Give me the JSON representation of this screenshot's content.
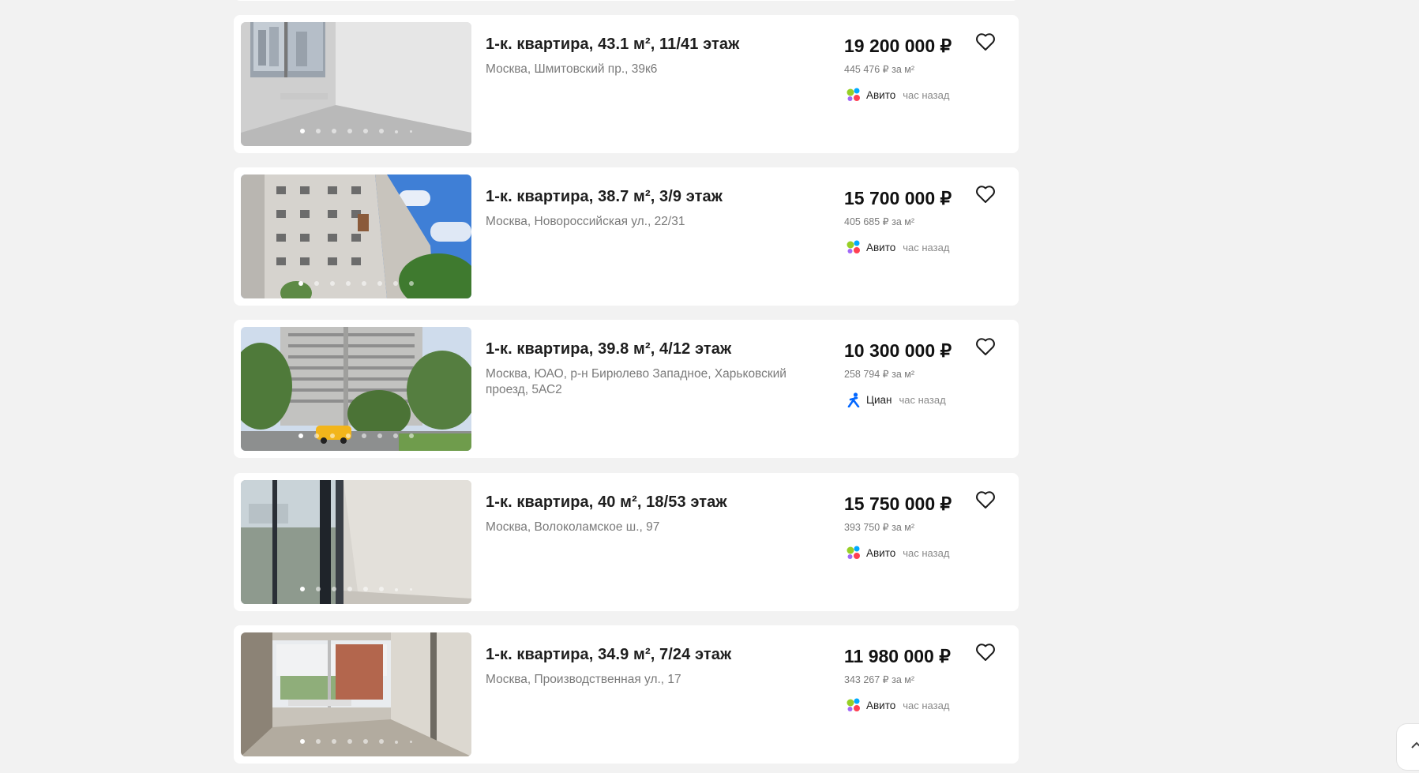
{
  "listings": [
    {
      "title": "1-к. квартира, 43.1 м², 11/41 этаж",
      "address": "Москва, Шмитовский пр., 39к6",
      "price": "19 200 000 ₽",
      "price_per_m2": "445 476 ₽ за м²",
      "source": "Авито",
      "source_icon": "avito-icon",
      "time": "час назад",
      "photo_icon": "empty-room-photo"
    },
    {
      "title": "1-к. квартира, 38.7 м², 3/9 этаж",
      "address": "Москва, Новороссийская ул., 22/31",
      "price": "15 700 000 ₽",
      "price_per_m2": "405 685 ₽ за м²",
      "source": "Авито",
      "source_icon": "avito-icon",
      "time": "час назад",
      "photo_icon": "building-exterior-photo"
    },
    {
      "title": "1-к. квартира, 39.8 м², 4/12 этаж",
      "address": "Москва, ЮАО, р-н Бирюлево Западное, Харьковский проезд, 5АС2",
      "price": "10 300 000 ₽",
      "price_per_m2": "258 794 ₽ за м²",
      "source": "Циан",
      "source_icon": "cian-icon",
      "time": "час назад",
      "photo_icon": "building-street-photo"
    },
    {
      "title": "1-к. квартира, 40 м², 18/53 этаж",
      "address": "Москва, Волоколамское ш., 97",
      "price": "15 750 000 ₽",
      "price_per_m2": "393 750 ₽ за м²",
      "source": "Авито",
      "source_icon": "avito-icon",
      "time": "час назад",
      "photo_icon": "window-view-photo"
    },
    {
      "title": "1-к. квартира, 34.9 м², 7/24 этаж",
      "address": "Москва, Производственная ул., 17",
      "price": "11 980 000 ₽",
      "price_per_m2": "343 267 ₽ за м²",
      "source": "Авито",
      "source_icon": "avito-icon",
      "time": "час назад",
      "photo_icon": "window-room-photo"
    }
  ],
  "colors": {
    "background": "#f2f2f2",
    "card": "#ffffff",
    "avito_green": "#97cf26",
    "avito_blue": "#0af",
    "avito_red": "#ff4053",
    "avito_purple": "#a169f7",
    "cian_blue": "#0468ff"
  }
}
